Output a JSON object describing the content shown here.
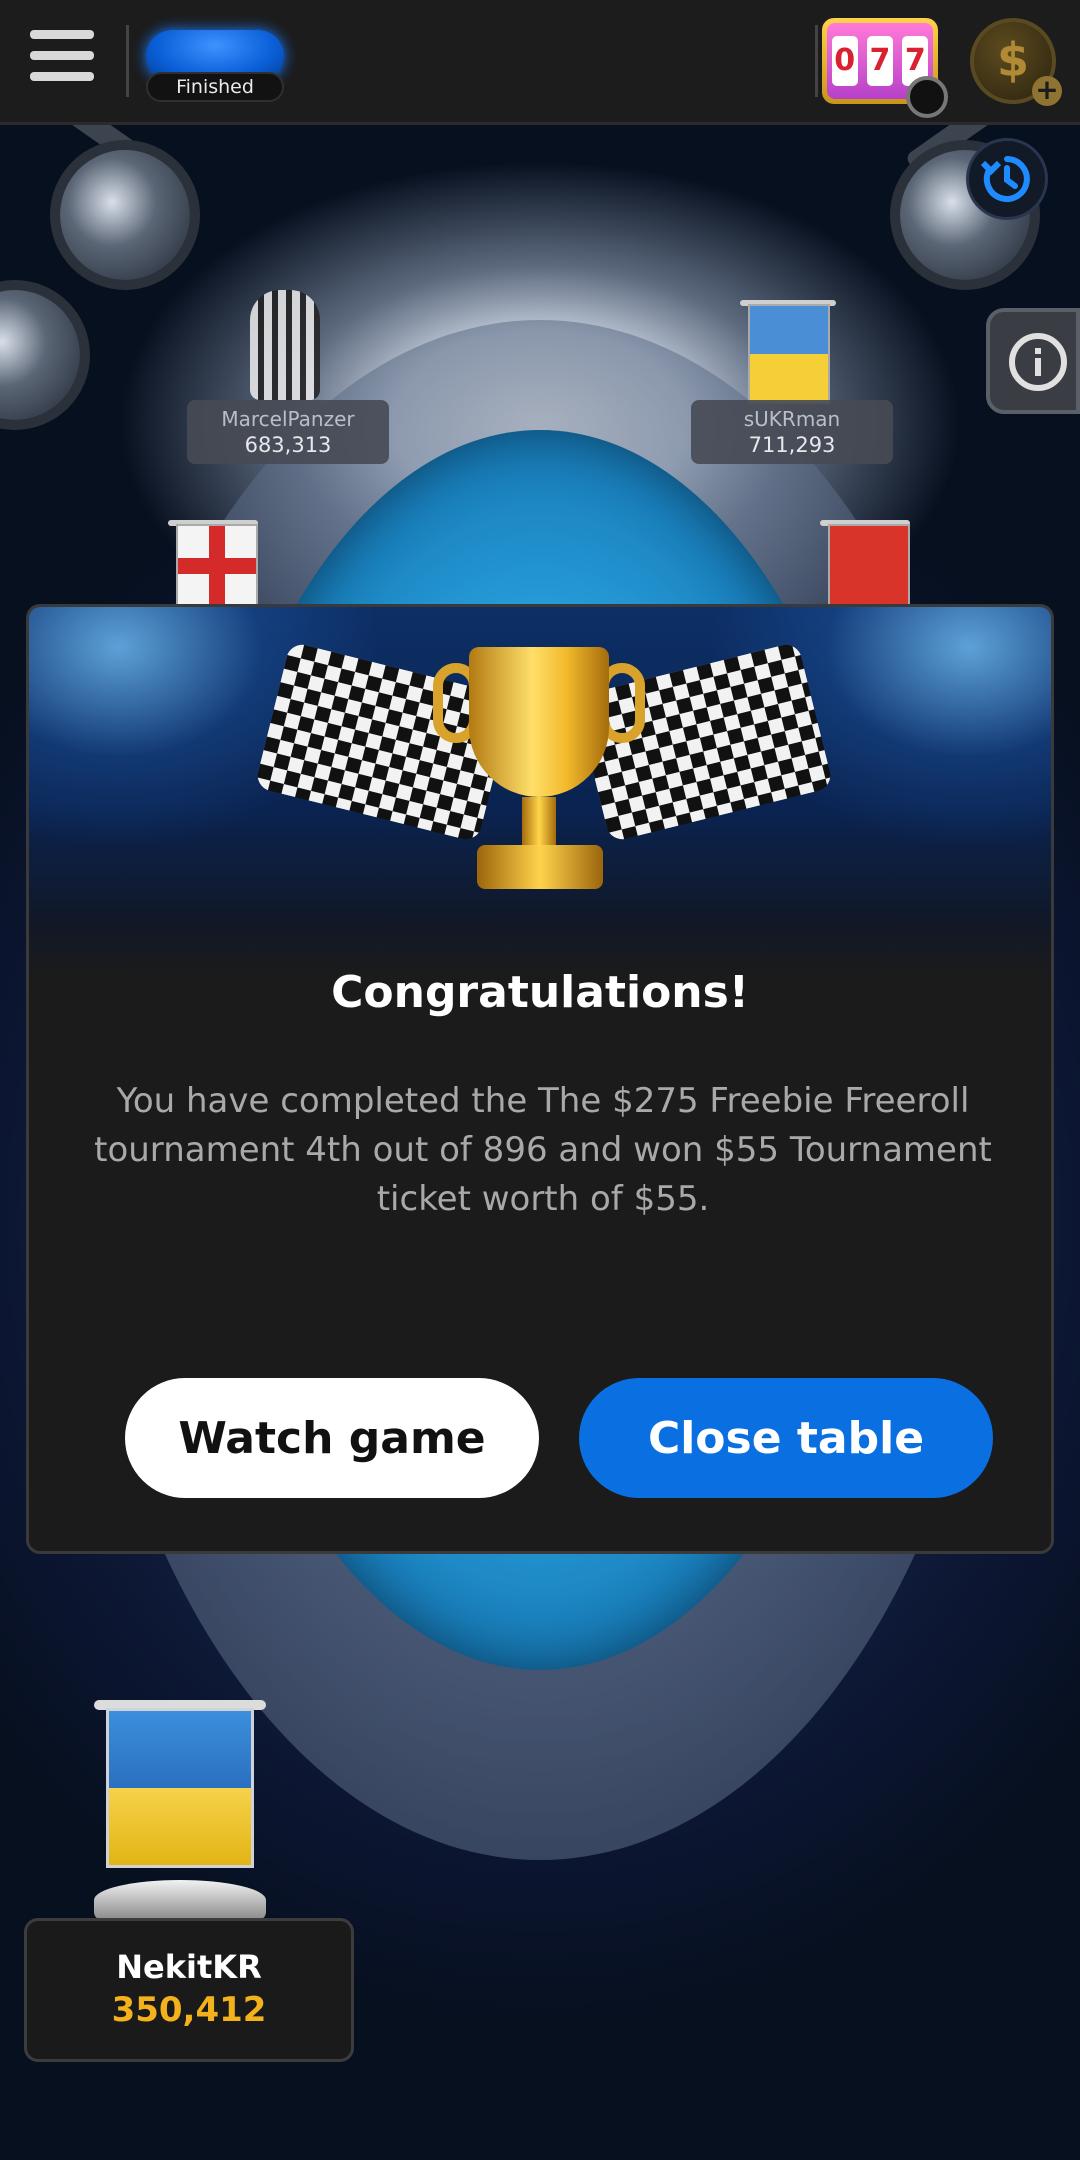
{
  "topbar": {
    "status_label": "Finished",
    "icons": [
      "menu-icon",
      "slot-machine-icon",
      "coin-plus-icon"
    ]
  },
  "table": {
    "players": [
      {
        "name": "MarcelPanzer",
        "chips": "683,313"
      },
      {
        "name": "sUKRman",
        "chips": "711,293"
      }
    ],
    "hero": {
      "name": "NekitKR",
      "chips": "350,412"
    }
  },
  "modal": {
    "title": "Congratulations!",
    "message": "You have completed the The $275 Freebie Freeroll tournament 4th out of 896 and won $55 Tournament ticket worth of $55.",
    "watch_label": "Watch game",
    "close_label": "Close table"
  },
  "colors": {
    "accent_blue": "#0a6fe0",
    "chip_gold": "#f3b21b",
    "modal_bg": "#1b1b1b"
  }
}
